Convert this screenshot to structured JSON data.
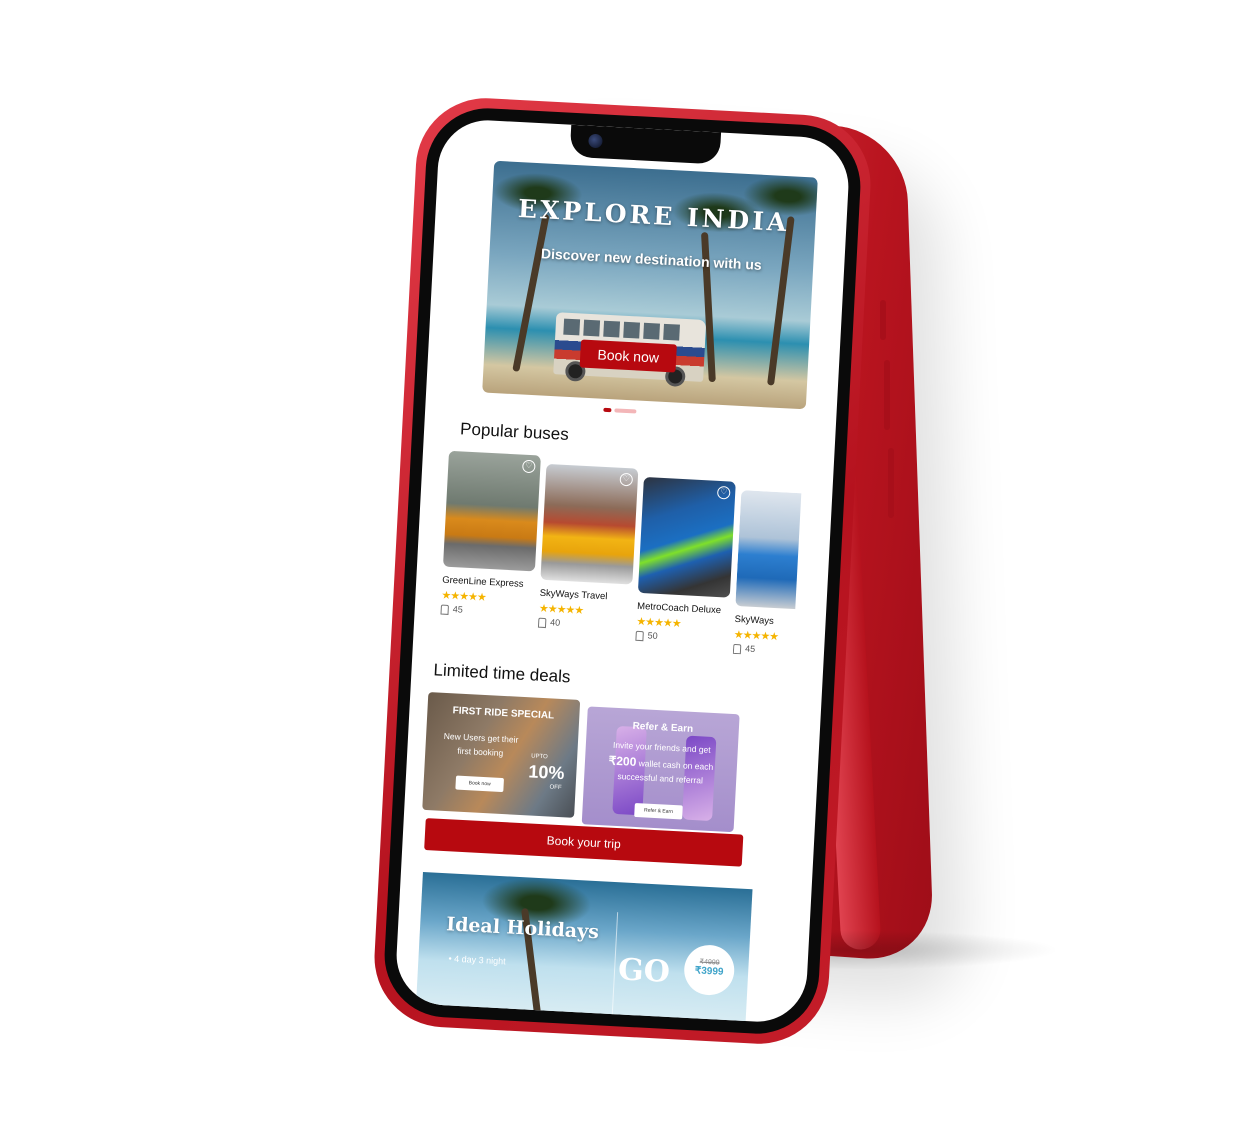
{
  "hero": {
    "title": "EXPLORE INDIA",
    "subtitle": "Discover new destination with us",
    "cta_label": "Book now"
  },
  "popular": {
    "title": "Popular buses",
    "buses": [
      {
        "name": "GreenLine Express",
        "rating": 5,
        "stars": "★★★★★",
        "seats": "45",
        "image": "orange-school-bus"
      },
      {
        "name": "SkyWays Travel",
        "rating": 5,
        "stars": "★★★★★",
        "seats": "40",
        "image": "yellow-city-bus"
      },
      {
        "name": "MetroCoach Deluxe",
        "rating": 5,
        "stars": "★★★★★",
        "seats": "50",
        "image": "blue-double-decker"
      },
      {
        "name": "SkyWays",
        "rating": 5,
        "stars": "★★★★★",
        "seats": "45",
        "image": "blue-city-bus"
      }
    ]
  },
  "deals": {
    "title": "Limited time deals",
    "first_ride": {
      "title": "FIRST RIDE SPECIAL",
      "text": "New Users get their first booking",
      "upto": "UPTO",
      "percent": "10%",
      "off": "OFF",
      "button": "Book now"
    },
    "refer": {
      "title": "Refer & Earn",
      "text_line1": "Invite your friends and get",
      "amount": "₹200",
      "text_line2": "wallet cash on each successful and referral",
      "button": "Refer & Earn"
    }
  },
  "book_trip_label": "Book your trip",
  "holiday": {
    "title": "Ideal Holidays",
    "duration": "4 day 3 night",
    "go": "GO",
    "old_price": "₹4999",
    "new_price": "₹3999"
  },
  "colors": {
    "brand_red": "#b7090f",
    "phone_red": "#c41d29",
    "star": "#f5b400",
    "refer_purple": "#b49dd0"
  }
}
